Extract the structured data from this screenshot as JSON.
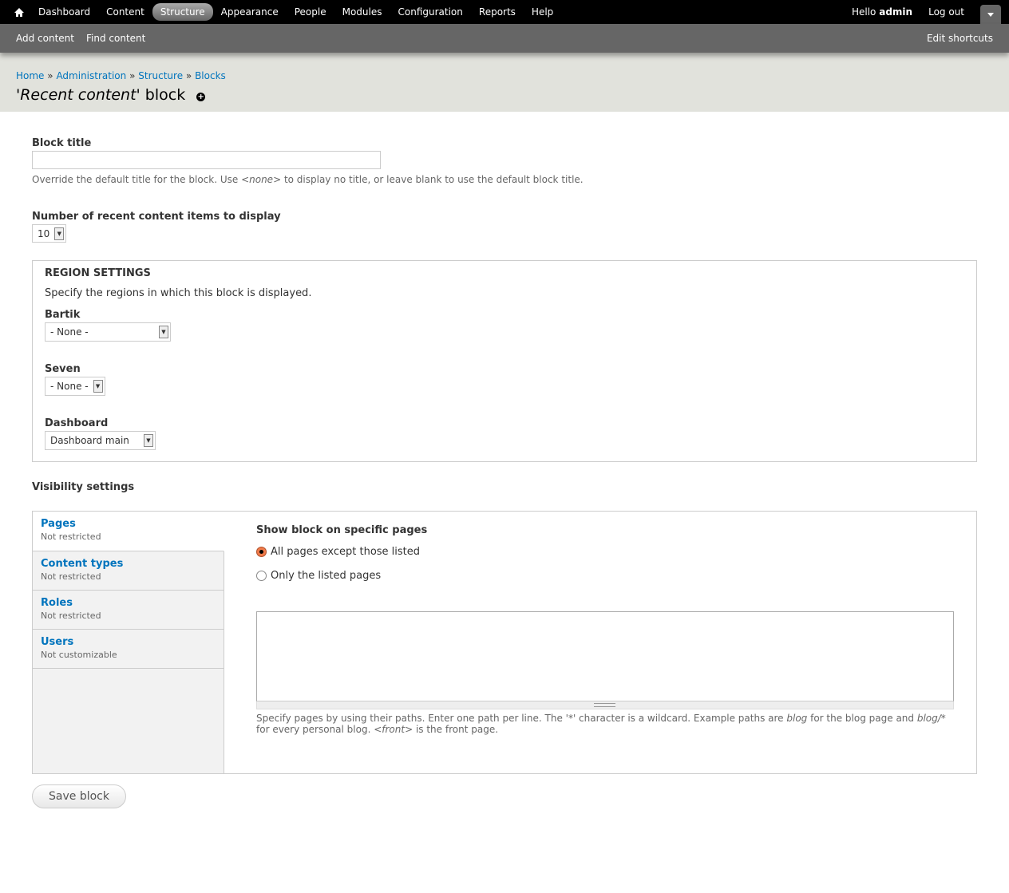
{
  "toolbar": {
    "items": [
      "Dashboard",
      "Content",
      "Structure",
      "Appearance",
      "People",
      "Modules",
      "Configuration",
      "Reports",
      "Help"
    ],
    "active": "Structure",
    "hello": "Hello",
    "user": "admin",
    "logout": "Log out"
  },
  "shortcuts": {
    "items": [
      "Add content",
      "Find content"
    ],
    "edit": "Edit shortcuts"
  },
  "breadcrumb": [
    "Home",
    "Administration",
    "Structure",
    "Blocks"
  ],
  "breadcrumb_sep": "»",
  "title": {
    "quote_open": "'",
    "italic": "Recent content",
    "rest": "' block"
  },
  "form": {
    "block_title": {
      "label": "Block title",
      "value": "",
      "desc_a": "Override the default title for the block. Use ",
      "desc_em": "<none>",
      "desc_b": " to display no title, or leave blank to use the default block title."
    },
    "count": {
      "label": "Number of recent content items to display",
      "value": "10"
    },
    "region": {
      "legend": "Region settings",
      "desc": "Specify the regions in which this block is displayed.",
      "themes": [
        {
          "label": "Bartik",
          "value": "- None -"
        },
        {
          "label": "Seven",
          "value": "- None -"
        },
        {
          "label": "Dashboard",
          "value": "Dashboard main"
        }
      ]
    },
    "visibility": {
      "heading": "Visibility settings",
      "tabs": [
        {
          "title": "Pages",
          "summary": "Not restricted"
        },
        {
          "title": "Content types",
          "summary": "Not restricted"
        },
        {
          "title": "Roles",
          "summary": "Not restricted"
        },
        {
          "title": "Users",
          "summary": "Not customizable"
        }
      ],
      "pane_title": "Show block on specific pages",
      "options": [
        "All pages except those listed",
        "Only the listed pages"
      ],
      "selected": 0,
      "pages_value": "",
      "help": {
        "a": "Specify pages by using their paths. Enter one path per line. The '*' character is a wildcard. Example paths are ",
        "em1": "blog",
        "b": " for the blog page and ",
        "em2": "blog/*",
        "c": " for every personal blog. ",
        "em3": "<front>",
        "d": " is the front page."
      }
    },
    "save": "Save block"
  }
}
